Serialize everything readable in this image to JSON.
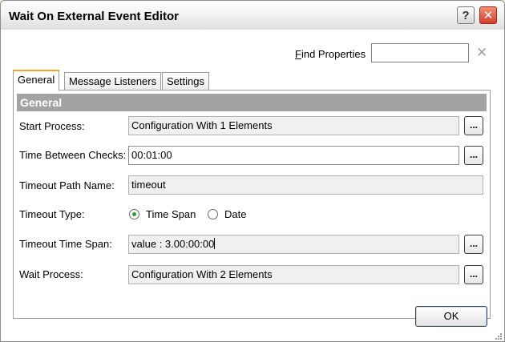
{
  "window": {
    "title": "Wait On External Event Editor",
    "help_label": "?",
    "close_label": "✕"
  },
  "find": {
    "label": "Find Properties",
    "value": "",
    "clear_label": "✕"
  },
  "tabs": [
    {
      "label": "General",
      "active": true
    },
    {
      "label": "Message Listeners",
      "active": false
    },
    {
      "label": "Settings",
      "active": false
    }
  ],
  "general": {
    "header": "General",
    "start_process": {
      "label": "Start Process:",
      "value": "Configuration With 1 Elements",
      "button": "..."
    },
    "time_between_checks": {
      "label": "Time Between Checks:",
      "value": "00:01:00",
      "button": "..."
    },
    "timeout_path_name": {
      "label": "Timeout Path Name:",
      "value": "timeout"
    },
    "timeout_type": {
      "label": "Timeout Type:",
      "options": [
        {
          "label": "Time Span",
          "selected": true
        },
        {
          "label": "Date",
          "selected": false
        }
      ]
    },
    "timeout_time_span": {
      "label": "Timeout Time Span:",
      "value": "value : 3.00:00:00",
      "button": "..."
    },
    "wait_process": {
      "label": "Wait Process:",
      "value": "Configuration With 2 Elements",
      "button": "..."
    }
  },
  "footer": {
    "ok_label": "OK"
  },
  "colors": {
    "group_header": "#a3a3a3",
    "active_tab_accent": "#f5a623",
    "close_button": "#d1402a",
    "radio_selected": "#2ea12e"
  }
}
